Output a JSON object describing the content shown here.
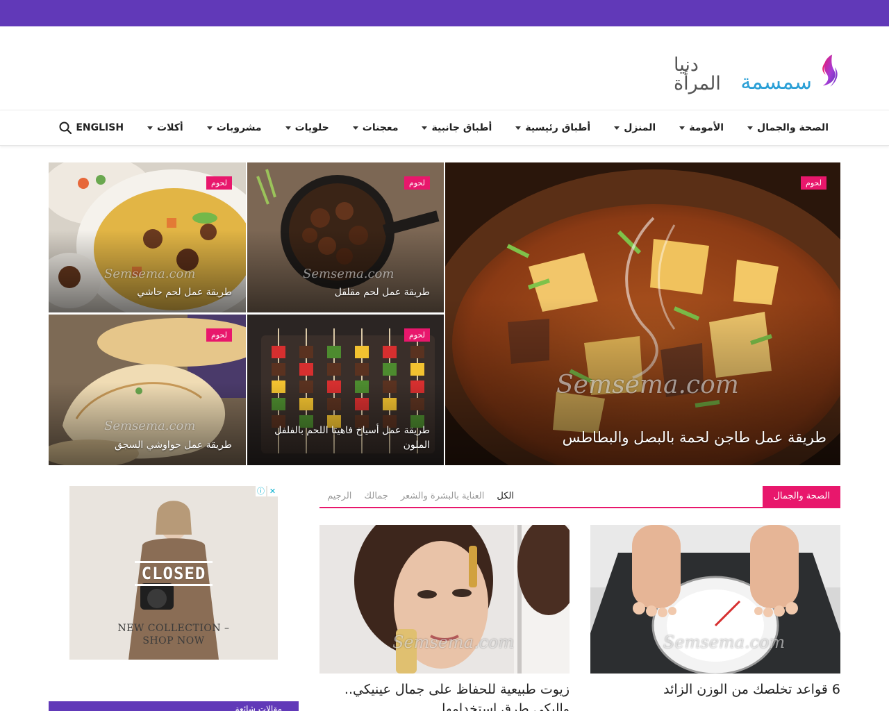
{
  "colors": {
    "brand_purple": "#6139b8",
    "accent_pink": "#e8176c",
    "logo_blue": "#2a9fd6"
  },
  "logo": {
    "name": "سمسمة",
    "tagline": "دنيا المرأة"
  },
  "nav": {
    "items": [
      {
        "label": "الصحة والجمال",
        "has_dropdown": true
      },
      {
        "label": "الأمومة",
        "has_dropdown": true
      },
      {
        "label": "المنزل",
        "has_dropdown": true
      },
      {
        "label": "أطباق رئيسية",
        "has_dropdown": true
      },
      {
        "label": "أطباق جانبية",
        "has_dropdown": true
      },
      {
        "label": "معجنات",
        "has_dropdown": true
      },
      {
        "label": "حلويات",
        "has_dropdown": true
      },
      {
        "label": "مشروبات",
        "has_dropdown": true
      },
      {
        "label": "أكلات",
        "has_dropdown": true
      },
      {
        "label": "ENGLISH",
        "has_dropdown": false
      }
    ],
    "search_icon": "search-icon"
  },
  "hero": {
    "main": {
      "category": "لحوم",
      "title": "طريقة عمل طاجن لحمة بالبصل والبطاطس",
      "watermark": "Semsema.com"
    },
    "tiles": [
      {
        "category": "لحوم",
        "title": "طريقة عمل لحم مقلقل",
        "watermark": "Semsema.com"
      },
      {
        "category": "لحوم",
        "title": "طريقة عمل لحم حاشي",
        "watermark": "Semsema.com"
      },
      {
        "category": "لحوم",
        "title": "طريقة عمل أسياخ فاهيتا اللحم بالفلفل الملون",
        "watermark": ""
      },
      {
        "category": "لحوم",
        "title": "طريقة عمل حواوشي السجق",
        "watermark": "Semsema.com"
      }
    ]
  },
  "section": {
    "label": "الصحة والجمال",
    "tabs": [
      "الكل",
      "العناية بالبشرة والشعر",
      "جمالك",
      "الرجيم"
    ],
    "active_tab": 0
  },
  "cards": [
    {
      "title": "6 قواعد تخلصك من الوزن الزائد",
      "watermark": "Semsema.com"
    },
    {
      "title": "زيوت طبيعية للحفاظ على جمال عينيكي.. وإليكي طرق استخدامها",
      "watermark": "Semsema.com"
    }
  ],
  "ad": {
    "closed_label": "CLOSED",
    "cta_line1": "NEW COLLECTION –",
    "cta_line2": "SHOP NOW",
    "info_icon": "ad-info-icon",
    "close_icon": "ad-close-icon"
  },
  "sidebar": {
    "widget_title": "مقالات شائعة"
  }
}
